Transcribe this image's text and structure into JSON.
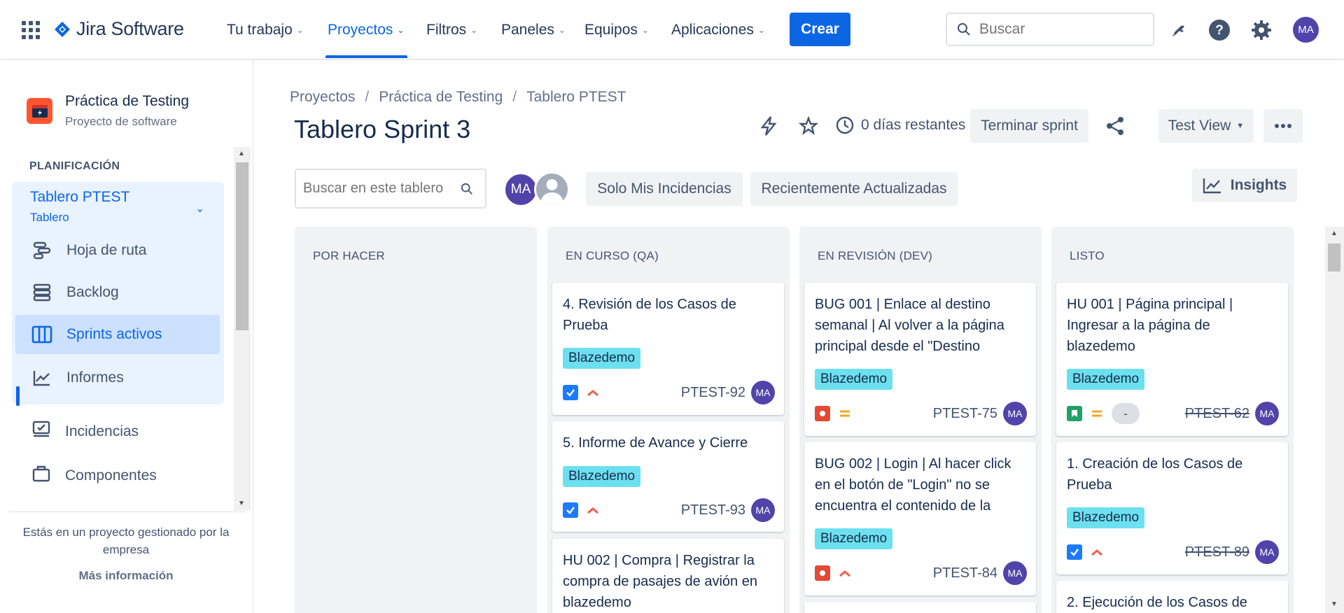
{
  "topnav": {
    "brand": "Jira Software",
    "items": [
      {
        "label": "Tu trabajo"
      },
      {
        "label": "Proyectos"
      },
      {
        "label": "Filtros"
      },
      {
        "label": "Paneles"
      },
      {
        "label": "Equipos"
      },
      {
        "label": "Aplicaciones"
      }
    ],
    "create_label": "Crear",
    "search_placeholder": "Buscar",
    "avatar_initials": "MA",
    "icons": [
      "app-switcher-icon",
      "notifications-icon",
      "help-icon",
      "settings-icon"
    ]
  },
  "sidebar": {
    "project_name": "Práctica de Testing",
    "project_type": "Proyecto de software",
    "section_label": "PLANIFICACIÓN",
    "board_title": "Tablero PTEST",
    "board_subtitle": "Tablero",
    "items": [
      {
        "label": "Hoja de ruta",
        "icon": "roadmap-icon"
      },
      {
        "label": "Backlog",
        "icon": "backlog-icon"
      },
      {
        "label": "Sprints activos",
        "icon": "board-icon",
        "active": true
      },
      {
        "label": "Informes",
        "icon": "reports-icon"
      }
    ],
    "extra_items": [
      {
        "label": "Incidencias",
        "icon": "issues-icon"
      },
      {
        "label": "Componentes",
        "icon": "components-icon"
      }
    ],
    "footer_text": "Estás en un proyecto gestionado por la empresa",
    "footer_link": "Más información"
  },
  "main": {
    "breadcrumb": [
      "Proyectos",
      "Práctica de Testing",
      "Tablero PTEST"
    ],
    "title": "Tablero Sprint 3",
    "days_left": "0 días restantes",
    "complete_sprint": "Terminar sprint",
    "view_label": "Test View",
    "board_search_placeholder": "Buscar en este tablero",
    "filter_avatar": "MA",
    "quick_filters": [
      "Solo Mis Incidencias",
      "Recientemente Actualizadas"
    ],
    "insights_label": "Insights"
  },
  "columns": [
    {
      "title": "POR HACER",
      "cards": []
    },
    {
      "title": "EN CURSO (QA)",
      "cards": [
        {
          "text": "4. Revisión de los Casos de Prueba",
          "label": "Blazedemo",
          "type": "task",
          "priority": "high",
          "key": "PTEST-92",
          "assignee": "MA"
        },
        {
          "text": "5. Informe de Avance y Cierre",
          "label": "Blazedemo",
          "type": "task",
          "priority": "high",
          "key": "PTEST-93",
          "assignee": "MA"
        },
        {
          "text": "HU 002 | Compra | Registrar la compra de pasajes de avión en blazedemo"
        }
      ]
    },
    {
      "title": "EN REVISIÓN (DEV)",
      "cards": [
        {
          "text": "BUG 001 | Enlace al destino semanal | Al volver a la página principal desde el \"Destino",
          "label": "Blazedemo",
          "type": "bug",
          "priority": "medium",
          "key": "PTEST-75",
          "assignee": "MA"
        },
        {
          "text": "BUG 002 | Login | Al hacer click en el botón de \"Login\" no se encuentra el contenido de la",
          "label": "Blazedemo",
          "type": "bug",
          "priority": "high",
          "key": "PTEST-84",
          "assignee": "MA"
        }
      ]
    },
    {
      "title": "LISTO",
      "cards": [
        {
          "text": "HU 001 | Página principal | Ingresar a la página de blazedemo",
          "label": "Blazedemo",
          "type": "story",
          "priority": "medium",
          "estimate": "-",
          "key": "PTEST-62",
          "assignee": "MA",
          "done": true
        },
        {
          "text": "1. Creación de los Casos de Prueba",
          "label": "Blazedemo",
          "type": "task",
          "priority": "high",
          "key": "PTEST-89",
          "assignee": "MA",
          "done": true
        },
        {
          "text": "2. Ejecución de los Casos de"
        }
      ]
    }
  ],
  "colors": {
    "primary": "#0C66E4",
    "label_bg": "#6CE0EF",
    "avatar": "#5243AA",
    "project_icon": "#FF5630",
    "bug": "#E34935",
    "story": "#22A06B",
    "task": "#1D7AFC",
    "priority_high": "#F15B50",
    "priority_medium": "#F5A623"
  }
}
